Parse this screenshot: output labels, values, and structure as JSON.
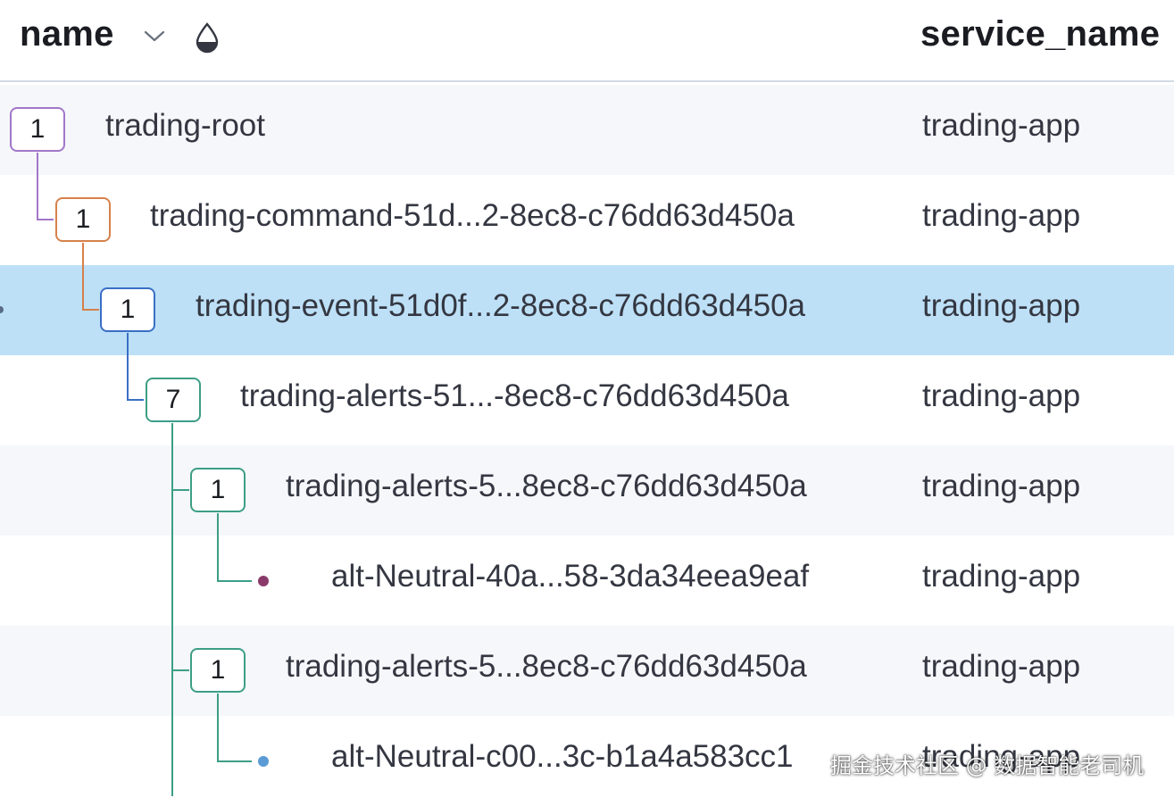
{
  "header": {
    "name_label": "name",
    "sort_icon": "chevron-down-icon",
    "field_icon": "drop-icon",
    "service_label": "service_name"
  },
  "colors": {
    "level0": "#a277c9",
    "level1": "#d6814b",
    "level2": "#3a6fc4",
    "level3": "#3d9e86",
    "selected_row": "#bde0f7",
    "dot_purple": "#8a3a6a",
    "dot_blue": "#5b9bd5"
  },
  "rows": [
    {
      "count": "1",
      "name": "trading-root",
      "service": "trading-app"
    },
    {
      "count": "1",
      "name": "trading-command-51d...2-8ec8-c76dd63d450a",
      "service": "trading-app"
    },
    {
      "count": "1",
      "name": "trading-event-51d0f...2-8ec8-c76dd63d450a",
      "service": "trading-app",
      "selected": true
    },
    {
      "count": "7",
      "name": "trading-alerts-51...-8ec8-c76dd63d450a",
      "service": "trading-app"
    },
    {
      "count": "1",
      "name": "trading-alerts-5...8ec8-c76dd63d450a",
      "service": "trading-app"
    },
    {
      "count": "",
      "name": "alt-Neutral-40a...58-3da34eea9eaf",
      "service": "trading-app"
    },
    {
      "count": "1",
      "name": "trading-alerts-5...8ec8-c76dd63d450a",
      "service": "trading-app"
    },
    {
      "count": "",
      "name": "alt-Neutral-c00...3c-b1a4a583cc1",
      "service": "trading-app"
    }
  ],
  "watermark": "掘金技术社区 @ 数据智能老司机"
}
